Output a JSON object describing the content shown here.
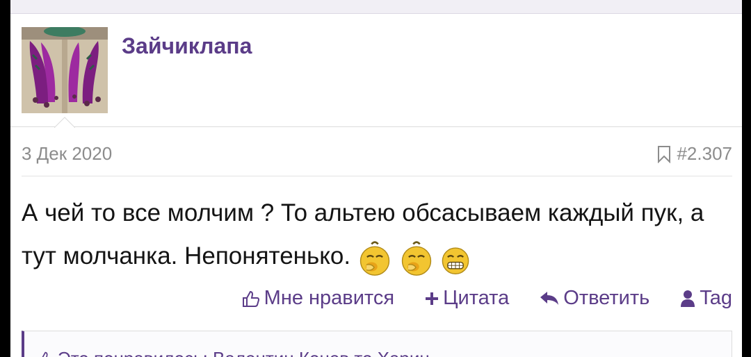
{
  "user": {
    "name": "Зайчиклапа",
    "avatar_icon": "avatar-image"
  },
  "post": {
    "date": "3 Дек 2020",
    "number": "#2.307",
    "text": "А чей то все молчим ? То альтею обсасываем каждый пук, а тут молчанка. Непонятенько.",
    "emojis": [
      "yawn-smiley-icon",
      "yawn-smiley-icon",
      "grin-smiley-icon"
    ]
  },
  "actions": {
    "like": "Мне нравится",
    "quote": "Цитата",
    "reply": "Ответить",
    "tag": "Tag"
  },
  "reactions": {
    "text": "Это понравилось: Валентин Конев то Харин"
  },
  "colors": {
    "accent": "#5b3c88",
    "meta": "#8c8c8c",
    "text": "#141414"
  }
}
